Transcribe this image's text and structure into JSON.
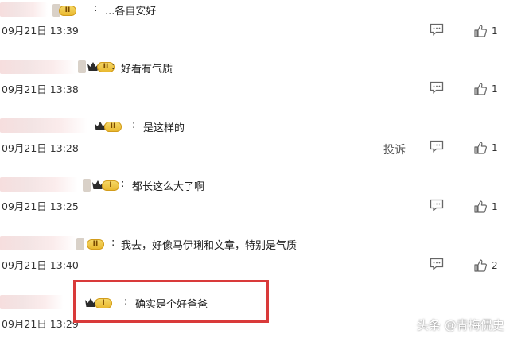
{
  "comments": [
    {
      "text": "...各自安好",
      "time": "09月21日 13:39",
      "likes": "1",
      "level": "II"
    },
    {
      "text": "好看有气质",
      "time": "09月21日 13:38",
      "likes": "1",
      "level": "II"
    },
    {
      "text": "是这样的",
      "time": "09月21日 13:28",
      "likes": "1",
      "level": "II",
      "report_label": "投诉"
    },
    {
      "text": "都长这么大了啊",
      "time": "09月21日 13:25",
      "likes": "1",
      "level": "I"
    },
    {
      "text": "我去，好像马伊琍和文章，特别是气质",
      "time": "09月21日 13:40",
      "likes": "2",
      "level": "II"
    },
    {
      "text": "确实是个好爸爸",
      "time": "09月21日 13:29",
      "likes": "",
      "level": "I"
    }
  ],
  "colon": ":",
  "watermark": "头条 @青梅侃史",
  "colors": {
    "highlight": "#d93a3a",
    "badge": "#e8b62b"
  }
}
